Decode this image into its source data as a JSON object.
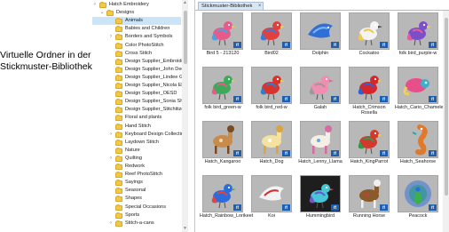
{
  "callout": {
    "line1": "Virtuelle Ordner in der",
    "line2": "Stickmuster-Bibliothek"
  },
  "tree": {
    "items": [
      {
        "label": "Hatch Embroidery",
        "chev": "›",
        "indent": 0,
        "selected": false
      },
      {
        "label": "Designs",
        "chev": "⌄",
        "indent": 1,
        "selected": false
      },
      {
        "label": "Animals",
        "chev": "",
        "indent": 2,
        "selected": true
      },
      {
        "label": "Babies and Children",
        "chev": "",
        "indent": 2,
        "selected": false
      },
      {
        "label": "Borders and Symbols",
        "chev": "›",
        "indent": 2,
        "selected": false
      },
      {
        "label": "Color PhotoStitch",
        "chev": "",
        "indent": 2,
        "selected": false
      },
      {
        "label": "Cross Stitch",
        "chev": "",
        "indent": 2,
        "selected": false
      },
      {
        "label": "Design Supplier_Embroidery M",
        "chev": "",
        "indent": 2,
        "selected": false
      },
      {
        "label": "Design Supplier_John Deer",
        "chev": "",
        "indent": 2,
        "selected": false
      },
      {
        "label": "Design Supplier_Lindee G Embr",
        "chev": "",
        "indent": 2,
        "selected": false
      },
      {
        "label": "Design Supplier_Nicola Elliott",
        "chev": "",
        "indent": 2,
        "selected": false
      },
      {
        "label": "Design Supplier_OESD",
        "chev": "",
        "indent": 2,
        "selected": false
      },
      {
        "label": "Design Supplier_Sonia Showell",
        "chev": "",
        "indent": 2,
        "selected": false
      },
      {
        "label": "Design Supplier_Stitchitize",
        "chev": "",
        "indent": 2,
        "selected": false
      },
      {
        "label": "Floral and plants",
        "chev": "",
        "indent": 2,
        "selected": false
      },
      {
        "label": "Hand Stitch",
        "chev": "",
        "indent": 2,
        "selected": false
      },
      {
        "label": "Keyboard Design Collection",
        "chev": "›",
        "indent": 2,
        "selected": false
      },
      {
        "label": "Laydown Stitch",
        "chev": "",
        "indent": 2,
        "selected": false
      },
      {
        "label": "Nature",
        "chev": "",
        "indent": 2,
        "selected": false
      },
      {
        "label": "Quilting",
        "chev": "›",
        "indent": 2,
        "selected": false
      },
      {
        "label": "Redwork",
        "chev": "",
        "indent": 2,
        "selected": false
      },
      {
        "label": "Reef PhotoStitch",
        "chev": "",
        "indent": 2,
        "selected": false
      },
      {
        "label": "Sayings",
        "chev": "",
        "indent": 2,
        "selected": false
      },
      {
        "label": "Seasonal",
        "chev": "",
        "indent": 2,
        "selected": false
      },
      {
        "label": "Shapes",
        "chev": "",
        "indent": 2,
        "selected": false
      },
      {
        "label": "Special Occasions",
        "chev": "",
        "indent": 2,
        "selected": false
      },
      {
        "label": "Sports",
        "chev": "",
        "indent": 2,
        "selected": false
      },
      {
        "label": "Stitch-a-cans",
        "chev": "›",
        "indent": 2,
        "selected": false
      }
    ]
  },
  "library": {
    "tab_label": "Stickmuster-Bibliothek",
    "tab_close": "×",
    "badge_text": "ff",
    "designs": [
      {
        "label": "Bird 5 - 213120",
        "icon": "bird-icon",
        "dark": false
      },
      {
        "label": "Bird02",
        "icon": "bird-icon",
        "dark": false
      },
      {
        "label": "Dolphin",
        "icon": "dolphin-icon",
        "dark": false
      },
      {
        "label": "Cockatoo",
        "icon": "cockatoo-icon",
        "dark": false
      },
      {
        "label": "folk bird_purple-w",
        "icon": "bird-icon",
        "dark": false
      },
      {
        "label": "folk bird_green-w",
        "icon": "bird-icon",
        "dark": false
      },
      {
        "label": "folk bird_red-w",
        "icon": "bird-icon",
        "dark": false
      },
      {
        "label": "Galah",
        "icon": "galah-icon",
        "dark": false
      },
      {
        "label": "Hatch_Crimson Rosella",
        "icon": "parrot-icon",
        "dark": false
      },
      {
        "label": "Hatch_Cario_Chameleon",
        "icon": "chameleon-icon",
        "dark": false
      },
      {
        "label": "Hatch_Kangaroo",
        "icon": "kangaroo-icon",
        "dark": false
      },
      {
        "label": "Hatch_Dog",
        "icon": "dog-icon",
        "dark": false
      },
      {
        "label": "Hatch_Lenny_Llama",
        "icon": "llama-icon",
        "dark": false
      },
      {
        "label": "Hatch_KingParrot",
        "icon": "parrot-icon",
        "dark": false
      },
      {
        "label": "Hatch_Seahorse",
        "icon": "seahorse-icon",
        "dark": false
      },
      {
        "label": "Hatch_Rainbow_Lorikeet",
        "icon": "lorikeet-icon",
        "dark": false
      },
      {
        "label": "Koi",
        "icon": "fish-icon",
        "dark": false
      },
      {
        "label": "Hummingbird",
        "icon": "hummingbird-icon",
        "dark": true
      },
      {
        "label": "Running Horse",
        "icon": "horse-icon",
        "dark": false
      },
      {
        "label": "Peacock",
        "icon": "peacock-icon",
        "dark": false
      }
    ]
  },
  "colors": {
    "selection": "#cce4f7",
    "folder": "#f2c84b",
    "badge": "#1e5fb0",
    "thumb_bg": "#b8b8b8"
  }
}
